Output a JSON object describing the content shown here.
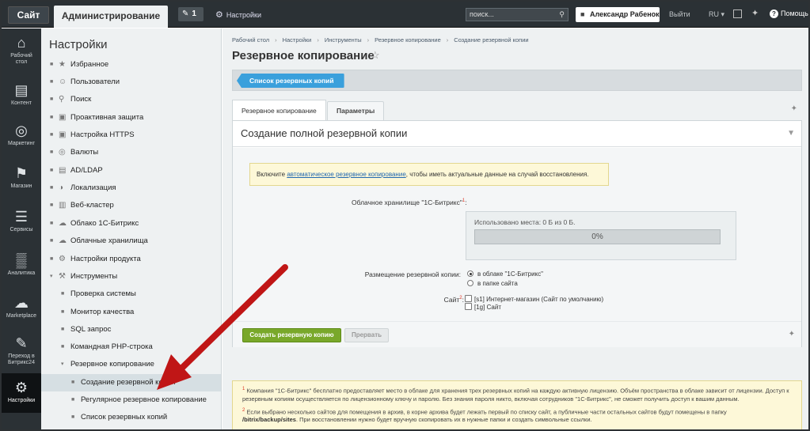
{
  "topbar": {
    "site_tab": "Сайт",
    "admin_tab": "Администрирование",
    "notifications_count": "1",
    "settings_link": "Настройки",
    "search_placeholder": "поиск...",
    "user_name": "Александр Рабенок",
    "logout": "Выйти",
    "language": "RU",
    "help": "Помощь"
  },
  "iconmenu": [
    {
      "label_line1": "Рабочий",
      "label_line2": "стол",
      "icon": "home-icon"
    },
    {
      "label_line1": "Контент",
      "label_line2": "",
      "icon": "document-icon"
    },
    {
      "label_line1": "Маркетинг",
      "label_line2": "",
      "icon": "target-icon"
    },
    {
      "label_line1": "Магазин",
      "label_line2": "",
      "icon": "basket-icon"
    },
    {
      "label_line1": "Сервисы",
      "label_line2": "",
      "icon": "layers-icon"
    },
    {
      "label_line1": "Аналитика",
      "label_line2": "",
      "icon": "chart-icon"
    },
    {
      "label_line1": "Marketplace",
      "label_line2": "",
      "icon": "cloud-download-icon"
    },
    {
      "label_line1": "Переход в",
      "label_line2": "Битрикс24",
      "icon": "bitrix24-icon"
    },
    {
      "label_line1": "Настройки",
      "label_line2": "",
      "icon": "gear-icon"
    }
  ],
  "tree": {
    "title": "Настройки",
    "items": [
      {
        "label": "Избранное",
        "icon": "star-icon"
      },
      {
        "label": "Пользователи",
        "icon": "user-icon"
      },
      {
        "label": "Поиск",
        "icon": "search-icon"
      },
      {
        "label": "Проактивная защита",
        "icon": "lock-icon"
      },
      {
        "label": "Настройка HTTPS",
        "icon": "padlock-icon"
      },
      {
        "label": "Валюты",
        "icon": "currency-icon"
      },
      {
        "label": "AD/LDAP",
        "icon": "ldap-icon"
      },
      {
        "label": "Локализация",
        "icon": "globe-icon"
      },
      {
        "label": "Веб-кластер",
        "icon": "cluster-icon"
      },
      {
        "label": "Облако 1С-Битрикс",
        "icon": "cloud-icon"
      },
      {
        "label": "Облачные хранилища",
        "icon": "storage-icon"
      },
      {
        "label": "Настройки продукта",
        "icon": "settings-icon"
      },
      {
        "label": "Инструменты",
        "icon": "tools-icon"
      },
      {
        "label": "Проверка системы",
        "icon": ""
      },
      {
        "label": "Монитор качества",
        "icon": ""
      },
      {
        "label": "SQL запрос",
        "icon": ""
      },
      {
        "label": "Командная PHP-строка",
        "icon": ""
      },
      {
        "label": "Резервное копирование",
        "icon": ""
      },
      {
        "label": "Создание резервной копии",
        "icon": ""
      },
      {
        "label": "Регулярное резервное копирование",
        "icon": ""
      },
      {
        "label": "Список резервных копий",
        "icon": ""
      }
    ]
  },
  "breadcrumbs": [
    "Рабочий стол",
    "Настройки",
    "Инструменты",
    "Резервное копирование",
    "Создание резервной копии"
  ],
  "page_title": "Резервное копирование",
  "toolbar": {
    "list_button": "Список резервных копий"
  },
  "tabs": {
    "backup": "Резервное копирование",
    "params": "Параметры"
  },
  "panel": {
    "title": "Создание полной резервной копии",
    "notice_before": "Включите ",
    "notice_link": "автоматическое резервное копирование",
    "notice_after": ", чтобы иметь актуальные данные на случай восстановления.",
    "cloud_label": "Облачное хранилище \"1С-Битрикс\"",
    "cloud_sup": "1",
    "cloud_used": "Использовано места: 0 Б из 0 Б.",
    "cloud_progress_text": "0%",
    "cloud_progress": 0,
    "placement_label": "Размещение резервной копии:",
    "placement_options": [
      "в облаке \"1С-Битрикс\"",
      "в папке сайта"
    ],
    "placement_selected": 0,
    "site_label": "Сайт",
    "site_sup": "2",
    "site_options": [
      "[s1] Интернет-магазин (Сайт по умолчанию)",
      "[1g] Сайт"
    ],
    "create_button": "Создать резервную копию",
    "stop_button": "Прервать"
  },
  "footnotes": {
    "note1_num": "1",
    "note1": "Компания \"1С-Битрикс\" бесплатно предоставляет место в облаке для хранения трех резервных копий на каждую активную лицензию. Объём пространства в облаке зависит от лицензии. Доступ к резервным копиям осуществляется по лицензионному ключу и паролю. Без знания пароля никто, включая сотрудников \"1С-Битрикс\", не сможет получить доступ к вашим данным.",
    "note2_num": "2",
    "note2": "Если выбрано несколько сайтов для помещения в архив, в корне архива будет лежать первый по списку сайт, а публичные части остальных сайтов будут помещены в папку",
    "note2_path": "/bitrix/backup/sites",
    "note2_tail": ". При восстановлении нужно будет вручную скопировать их в нужные папки и создать символьные ссылки."
  }
}
